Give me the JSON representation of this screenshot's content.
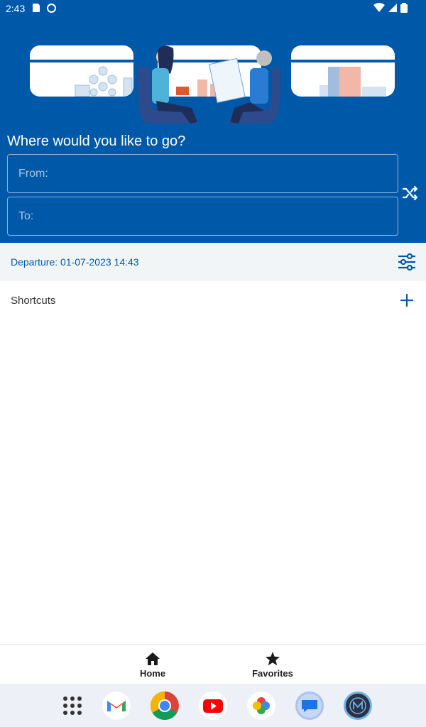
{
  "status_bar": {
    "time": "2:43"
  },
  "header": {
    "prompt": "Where would you like to go?",
    "from_placeholder": "From:",
    "to_placeholder": "To:"
  },
  "departure": {
    "label": "Departure: 01-07-2023 14:43"
  },
  "shortcuts": {
    "label": "Shortcuts"
  },
  "bottom_nav": {
    "home": "Home",
    "favorites": "Favorites"
  },
  "dock": {
    "apps": [
      "app-drawer",
      "gmail",
      "chrome",
      "youtube",
      "photos",
      "messages",
      "m-app"
    ]
  },
  "colors": {
    "primary": "#0058a8",
    "departure_bg": "#f1f5f6",
    "dock_bg": "#eef0f8"
  }
}
